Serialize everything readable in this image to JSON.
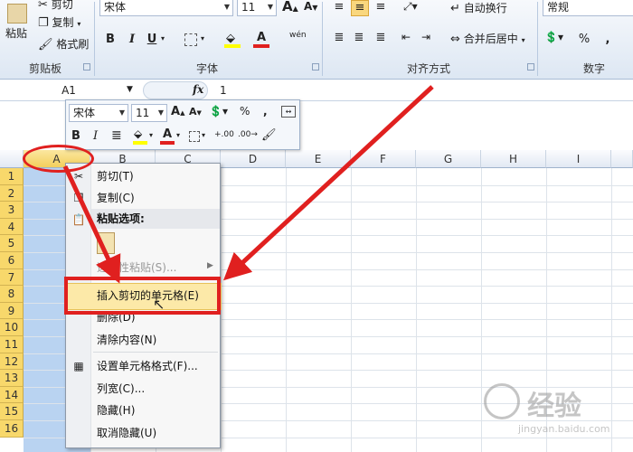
{
  "ribbon": {
    "clipboard": {
      "cut": "剪切",
      "copy": "复制",
      "paste": "粘贴",
      "format_painter": "格式刷",
      "label": "剪贴板"
    },
    "font": {
      "name": "宋体",
      "size": "11",
      "label": "字体",
      "bold": "B",
      "italic": "I",
      "underline": "U",
      "grow": "A",
      "shrink": "A",
      "font_color": "A",
      "phonetic": "wén"
    },
    "alignment": {
      "wrap": "自动换行",
      "merge": "合并后居中",
      "label": "对齐方式"
    },
    "number": {
      "format": "常规",
      "percent": "%",
      "comma": ",",
      "label": "数字"
    }
  },
  "formula_bar": {
    "name_box": "A1",
    "fx": "fx",
    "value": "1"
  },
  "columns": [
    "A",
    "B",
    "C",
    "D",
    "E",
    "F",
    "G",
    "H",
    "I"
  ],
  "rows": [
    "1",
    "2",
    "3",
    "4",
    "5",
    "6",
    "7",
    "8",
    "9",
    "10",
    "11",
    "12",
    "13",
    "14",
    "15",
    "16"
  ],
  "mini_toolbar": {
    "font_name": "宋体",
    "font_size": "11",
    "bold": "B",
    "italic": "I",
    "percent": "%",
    "comma": ","
  },
  "context_menu": {
    "cut": "剪切(T)",
    "copy": "复制(C)",
    "paste_options": "粘贴选项:",
    "paste_special": "选择性粘贴(S)...",
    "insert_cut_cells": "插入剪切的单元格(E)",
    "delete": "删除(D)",
    "clear_contents": "清除内容(N)",
    "format_cells": "设置单元格格式(F)...",
    "column_width": "列宽(C)...",
    "hide": "隐藏(H)",
    "unhide": "取消隐藏(U)"
  },
  "watermark": {
    "text": "经验",
    "site": "jingyan.baidu.com"
  },
  "colors": {
    "annotation": "#e0201f",
    "row_header": "#f8d86b",
    "selection": "#b9d3f1",
    "highlight": "#fce9a8"
  }
}
